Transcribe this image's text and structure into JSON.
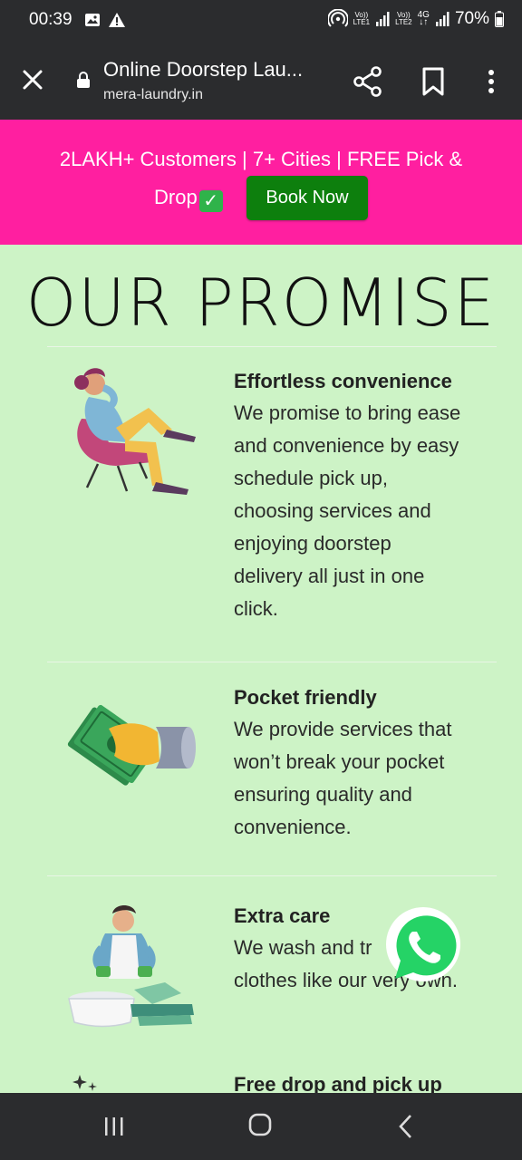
{
  "status": {
    "time": "00:39",
    "battery": "70%",
    "net1_top": "Vo))",
    "net1_bottom": "LTE1",
    "net2_top": "Vo))",
    "net2_bottom": "LTE2",
    "net2_type": "4G"
  },
  "browser": {
    "title": "Online Doorstep Lau...",
    "url": "mera-laundry.in"
  },
  "promo": {
    "line1": "2LAKH+ Customers | 7+ Cities | FREE Pick &",
    "line2": "Drop",
    "button": "Book Now",
    "color": "#ff1fa0",
    "button_color": "#0d7f0d"
  },
  "heading": "OUR PROMISE",
  "features": [
    {
      "title": "Effortless convenience",
      "lines": [
        "We promise to bring ease",
        "and convenience by easy",
        "schedule pick up,",
        "choosing services and",
        "enjoying doorstep",
        "delivery all just in one",
        "click."
      ],
      "icon": "relaxing-person-illustration"
    },
    {
      "title": "Pocket friendly",
      "lines": [
        "We provide services that",
        "won’t break your pocket",
        "ensuring quality and",
        "convenience."
      ],
      "icon": "hand-holding-money-illustration"
    },
    {
      "title": "Extra care",
      "lines": [
        "We wash and tr",
        "clothes like our very own."
      ],
      "icon": "man-washing-clothes-illustration"
    },
    {
      "title": "Free drop and pick up",
      "lines": [],
      "icon": "sparkle-icon"
    }
  ],
  "colors": {
    "background": "#cdf3c6",
    "bars": "#2b2c2e",
    "whatsapp": "#25d366"
  }
}
